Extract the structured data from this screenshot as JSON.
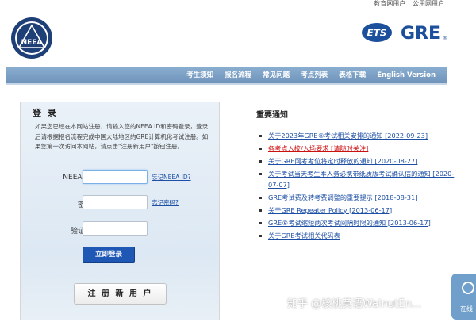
{
  "topbar": {
    "site_name": "",
    "links": [
      "教育网用户",
      "公用网用户"
    ]
  },
  "logos": {
    "neea_text": "NEEA",
    "ets_text": "ETS",
    "gre_text": "GRE"
  },
  "nav": {
    "items": [
      "考生须知",
      "报名流程",
      "常见问题",
      "考点列表",
      "表格下载",
      "English Version"
    ]
  },
  "login": {
    "title": "登 录",
    "description": "如果您已经在本网站注册，请输入您的NEEA ID和密码登录，登录后请根据报名流程完成中国大陆地区的GRE计算机化考试注册。如果您第一次访问本网站，请点击\"注册新用户\"按钮注册。",
    "neea_id_label": "NEEA ID",
    "neea_id_value": "",
    "forgot_id": "忘记NEEA ID?",
    "password_label": "密码",
    "password_value": "",
    "forgot_password": "忘记密码?",
    "captcha_label": "验证码",
    "captcha_value": "",
    "login_button": "立即登录",
    "register_button": "注 册 新 用 户"
  },
  "notices": {
    "title": "重要通知",
    "items": [
      {
        "text": "关于2023年GRE®考试相关安排的通知 [2022-09-23]",
        "color": "blue"
      },
      {
        "text": "各考点入校/入场要求 [请随时关注]",
        "color": "red"
      },
      {
        "text": "关于GRE网考考位将定时释放的通知 [2020-08-27]",
        "color": "blue"
      },
      {
        "text": "关于考试当天考生本人务必携带纸质版考试确认信的通知 [2020-07-07]",
        "color": "blue"
      },
      {
        "text": "GRE考试费及转考费调整的重要提示 [2018-08-31]",
        "color": "blue"
      },
      {
        "text": "关于GRE Repeater Policy [2013-06-17]",
        "color": "blue"
      },
      {
        "text": "GRE®考试缩短两次考试间隔时限的通知 [2013-06-17]",
        "color": "blue"
      },
      {
        "text": "关于GRE考试相关代码表",
        "color": "blue"
      }
    ]
  },
  "overlay": {
    "watermark": "知乎 @核桃英语WalnutEn...",
    "float_button_label": "在线"
  },
  "colors": {
    "nav_bg": "#7a9ec4",
    "link_blue": "#1d4fa5",
    "alert_red": "#cc1111",
    "login_btn": "#1f57b4"
  }
}
